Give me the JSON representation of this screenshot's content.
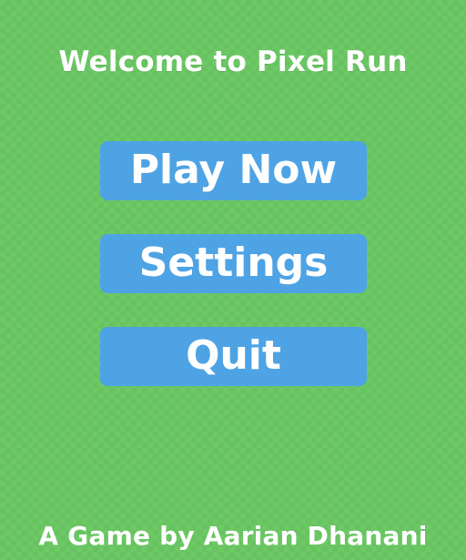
{
  "app": {
    "title": "Welcome to Pixel Run",
    "credits": "A Game by Aarian Dhanani"
  },
  "menu": {
    "items": [
      {
        "label": "Play Now"
      },
      {
        "label": "Settings"
      },
      {
        "label": "Quit"
      }
    ]
  },
  "colors": {
    "background": "#6cc965",
    "button": "#4ea3e4",
    "text": "#ffffff"
  }
}
